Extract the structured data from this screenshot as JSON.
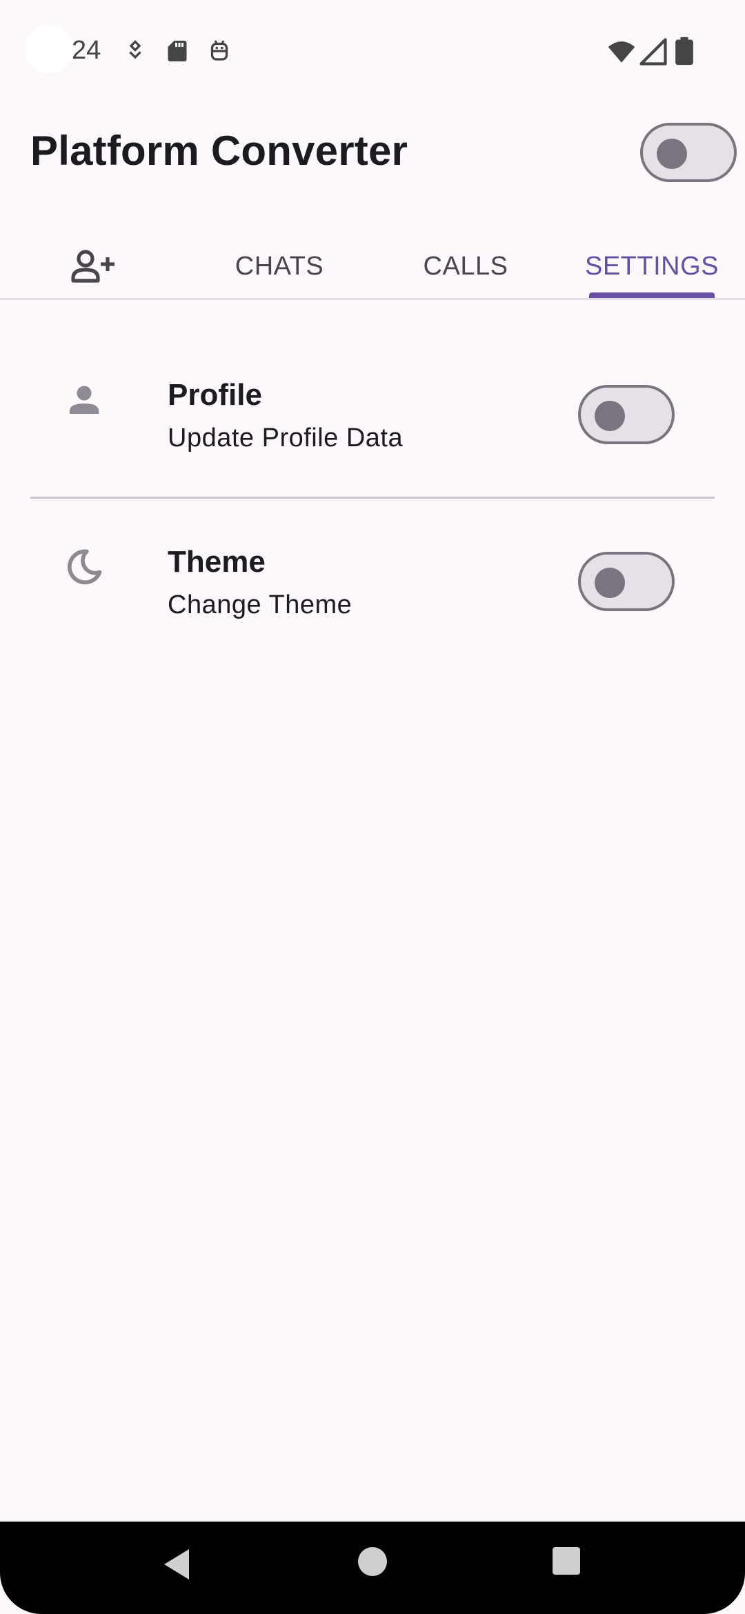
{
  "status_bar": {
    "time": "24",
    "icons": [
      "notification-icon",
      "sd-card-icon",
      "android-icon",
      "wifi-icon",
      "signal-icon",
      "battery-icon"
    ]
  },
  "app_bar": {
    "title": "Platform Converter",
    "theme_switch_on": false
  },
  "tabs": [
    {
      "label": "",
      "icon": "person-add-icon",
      "selected": false
    },
    {
      "label": "CHATS",
      "selected": false
    },
    {
      "label": "CALLS",
      "selected": false
    },
    {
      "label": "SETTINGS",
      "selected": true
    }
  ],
  "settings": [
    {
      "icon": "person-icon",
      "title": "Profile",
      "subtitle": "Update Profile Data",
      "switch_on": false
    },
    {
      "icon": "moon-icon",
      "title": "Theme",
      "subtitle": "Change Theme",
      "switch_on": false
    }
  ],
  "nav_bar": {
    "buttons": [
      "back-icon",
      "home-icon",
      "recents-icon"
    ]
  },
  "colors": {
    "background": "#fdf8fb",
    "accent": "#6750a4",
    "switch_track": "#e6e0e9",
    "switch_outline": "#79747e"
  }
}
